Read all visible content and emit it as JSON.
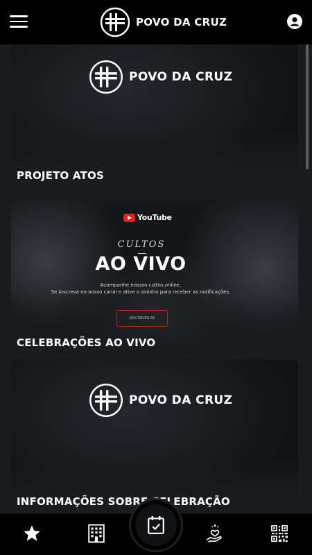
{
  "app": {
    "brand_name": "POVO DA CRUZ"
  },
  "cards": [
    {
      "title": "PROJETO ATOS",
      "logo_text": "POVO DA CRUZ"
    },
    {
      "title": "CELEBRAÇÕES AO VIVO",
      "youtube_label": "YouTube",
      "cultos": "CULTOS",
      "headline": "AO VIVO",
      "line1": "Acompanhe nossos cultos online.",
      "line2": "Se inscreva no nosso canal e ative o sininho para receber as notificações.",
      "button": "INSCREVER-SE"
    },
    {
      "title": "INFORMAÇÕES SOBRE CELEBRAÇÃO",
      "logo_text": "POVO DA CRUZ"
    }
  ],
  "bottom_nav": [
    {
      "icon": "star-icon"
    },
    {
      "icon": "building-icon"
    },
    {
      "icon": "calendar-check-icon"
    },
    {
      "icon": "heart-hand-icon"
    },
    {
      "icon": "qr-code-icon"
    }
  ],
  "colors": {
    "accent_red": "#e62117",
    "background": "#1a1d20",
    "bar": "#000000"
  }
}
